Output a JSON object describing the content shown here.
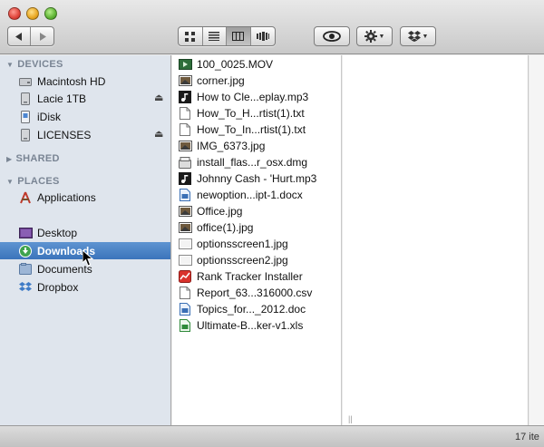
{
  "toolbar": {
    "nav_back_icon": "triangle-left",
    "nav_forward_icon": "triangle-right",
    "views": [
      "icon-view",
      "list-view",
      "column-view",
      "cover-flow-view"
    ],
    "selected_view": "column-view"
  },
  "sidebar": {
    "sections": {
      "devices": "DEVICES",
      "shared": "SHARED",
      "places": "PLACES"
    },
    "devices": [
      {
        "label": "Macintosh HD",
        "icon": "hard-drive-icon"
      },
      {
        "label": "Lacie 1TB",
        "icon": "external-drive-icon",
        "eject": true
      },
      {
        "label": "iDisk",
        "icon": "idisk-icon"
      },
      {
        "label": "LICENSES",
        "icon": "external-drive-icon",
        "eject": true
      }
    ],
    "places": [
      {
        "label": "Applications",
        "icon": "applications-icon"
      },
      {
        "label": "Desktop",
        "icon": "desktop-icon"
      },
      {
        "label": "Downloads",
        "icon": "downloads-icon",
        "selected": true
      },
      {
        "label": "Documents",
        "icon": "documents-icon"
      },
      {
        "label": "Dropbox",
        "icon": "dropbox-icon"
      }
    ]
  },
  "files": [
    {
      "name": "100_0025.MOV",
      "type": "movie"
    },
    {
      "name": "corner.jpg",
      "type": "image"
    },
    {
      "name": "How to Cle...eplay.mp3",
      "type": "audio"
    },
    {
      "name": "How_To_H...rtist(1).txt",
      "type": "text"
    },
    {
      "name": "How_To_In...rtist(1).txt",
      "type": "text"
    },
    {
      "name": "IMG_6373.jpg",
      "type": "image"
    },
    {
      "name": "install_flas...r_osx.dmg",
      "type": "disk-image"
    },
    {
      "name": "Johnny Cash - 'Hurt.mp3",
      "type": "audio"
    },
    {
      "name": "newoption...ipt-1.docx",
      "type": "word"
    },
    {
      "name": "Office.jpg",
      "type": "image"
    },
    {
      "name": "office(1).jpg",
      "type": "image"
    },
    {
      "name": "optionsscreen1.jpg",
      "type": "blank"
    },
    {
      "name": "optionsscreen2.jpg",
      "type": "blank"
    },
    {
      "name": "Rank Tracker Installer",
      "type": "app"
    },
    {
      "name": "Report_63...316000.csv",
      "type": "text"
    },
    {
      "name": "Topics_for..._2012.doc",
      "type": "word"
    },
    {
      "name": "Ultimate-B...ker-v1.xls",
      "type": "excel"
    }
  ],
  "status": {
    "text": "17 ite"
  },
  "colors": {
    "selection": "#3b74bb",
    "sidebar_bg": "#dfe5ed",
    "section_header": "#7a8594"
  }
}
